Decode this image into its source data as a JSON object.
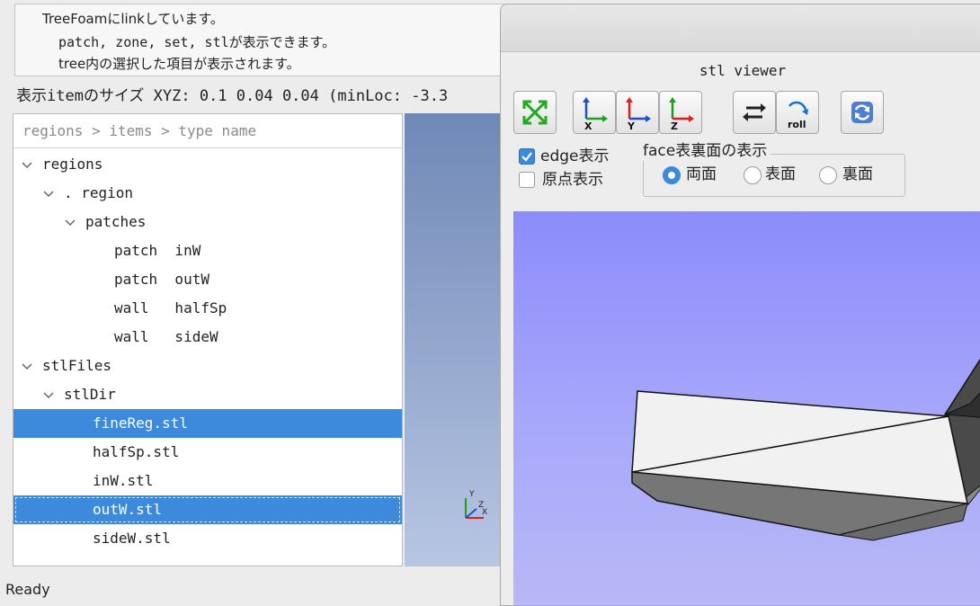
{
  "info": {
    "lines": [
      "TreeFoamにlinkしています。",
      "patch, zone, set, stlが表示できます。",
      "tree内の選択した項目が表示されます。"
    ]
  },
  "size_line": "表示itemのサイズ XYZ: 0.1 0.04 0.04  (minLoc: -3.3",
  "tree": {
    "header": "regions > items > type name",
    "rows": [
      "regions",
      ". region",
      "patches",
      "patch  inW",
      "patch  outW",
      "wall   halfSp",
      "wall   sideW",
      "stlFiles",
      "stlDir",
      "fineReg.stl",
      "halfSp.stl",
      "inW.stl",
      "outW.stl",
      "sideW.stl"
    ],
    "selected": [
      "fineReg.stl",
      "outW.stl"
    ]
  },
  "status": "Ready",
  "viewer": {
    "title": "stl viewer",
    "toolbar": {
      "fit": "fit-all-icon",
      "view_x": "view-x-axis-icon",
      "view_y": "view-y-axis-icon",
      "view_z": "view-z-axis-icon",
      "reverse": "reverse-view-icon",
      "roll_label": "roll",
      "reload": "reload-icon",
      "axis_x": "X",
      "axis_y": "Y",
      "axis_z": "Z"
    },
    "edge_label": "edge表示",
    "edge_checked": true,
    "origin_label": "原点表示",
    "origin_checked": false,
    "face_group_title": "face表裏面の表示",
    "face_options": [
      "両面",
      "表面",
      "裏面"
    ],
    "face_selected": "両面"
  },
  "colors": {
    "selection": "#3d89dc",
    "viewport_top": "#8c8cfb",
    "axis_x": "#e11d1d",
    "axis_y": "#1aa01a",
    "axis_z": "#1a4fd8"
  }
}
